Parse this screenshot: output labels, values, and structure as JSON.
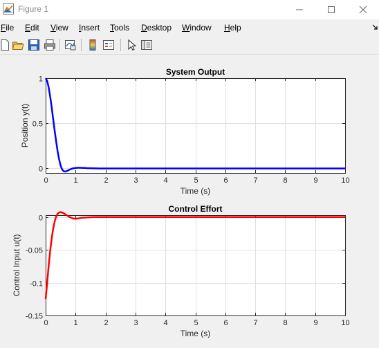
{
  "window": {
    "title": "Figure 1"
  },
  "menu": {
    "file": {
      "u": "F",
      "rest": "ile"
    },
    "edit": {
      "u": "E",
      "rest": "dit"
    },
    "view": {
      "u": "V",
      "rest": "iew"
    },
    "insert": {
      "u": "I",
      "rest": "nsert"
    },
    "tools": {
      "u": "T",
      "rest": "ools"
    },
    "desktop": {
      "u": "D",
      "rest": "esktop"
    },
    "window": {
      "u": "W",
      "rest": "indow"
    },
    "help": {
      "u": "H",
      "rest": "elp"
    }
  },
  "toolbar_icons": [
    "new-figure-icon",
    "open-file-icon",
    "save-icon",
    "print-icon",
    "link-plot-icon",
    "insert-colorbar-icon",
    "insert-legend-icon",
    "edit-plot-icon",
    "property-inspector-icon"
  ],
  "colors": {
    "series1": "#0000ff",
    "series2": "#ff0000",
    "grid": "#dfdfdf"
  },
  "chart_data": [
    {
      "type": "line",
      "title": "System Output",
      "xlabel": "Time (s)",
      "ylabel": "Position y(t)",
      "xlim": [
        0,
        10
      ],
      "ylim": [
        -0.05,
        1
      ],
      "xticks": [
        0,
        1,
        2,
        3,
        4,
        5,
        6,
        7,
        8,
        9,
        10
      ],
      "yticks": [
        0,
        0.5,
        1
      ],
      "ytick_labels": [
        "0",
        "0.5",
        "1"
      ],
      "grid": true,
      "series": [
        {
          "color": "#0000ff",
          "x": [
            0,
            0.05,
            0.1,
            0.15,
            0.2,
            0.25,
            0.3,
            0.35,
            0.4,
            0.45,
            0.5,
            0.55,
            0.6,
            0.65,
            0.7,
            0.75,
            0.8,
            0.85,
            0.9,
            1.0,
            1.1,
            1.2,
            1.3,
            1.4,
            1.6,
            1.8,
            2.0,
            3,
            4,
            5,
            6,
            7,
            8,
            9,
            10
          ],
          "y": [
            1,
            0.97,
            0.9,
            0.8,
            0.68,
            0.55,
            0.42,
            0.3,
            0.19,
            0.1,
            0.03,
            -0.01,
            -0.03,
            -0.035,
            -0.03,
            -0.022,
            -0.013,
            -0.006,
            0.0,
            0.006,
            0.008,
            0.007,
            0.005,
            0.003,
            0.001,
            0,
            0,
            0,
            0,
            0,
            0,
            0,
            0,
            0,
            0
          ]
        }
      ]
    },
    {
      "type": "line",
      "title": "Control Effort",
      "xlabel": "Time (s)",
      "ylabel": "Control Input u(t)",
      "xlim": [
        0,
        10
      ],
      "ylim": [
        -0.15,
        0.003
      ],
      "xticks": [
        0,
        1,
        2,
        3,
        4,
        5,
        6,
        7,
        8,
        9,
        10
      ],
      "yticks": [
        0,
        -0.05,
        -0.1,
        -0.15
      ],
      "ytick_labels": [
        "0",
        "-0.05",
        "-0.1",
        "-0.15"
      ],
      "grid": true,
      "series": [
        {
          "color": "#ff0000",
          "x": [
            0,
            0.05,
            0.1,
            0.15,
            0.2,
            0.25,
            0.3,
            0.35,
            0.4,
            0.45,
            0.5,
            0.55,
            0.6,
            0.7,
            0.8,
            0.9,
            1.0,
            1.1,
            1.2,
            1.4,
            1.6,
            2.0,
            3,
            4,
            5,
            6,
            7,
            8,
            9,
            10
          ],
          "y": [
            -0.125,
            -0.1,
            -0.075,
            -0.052,
            -0.033,
            -0.018,
            -0.007,
            0.001,
            0.005,
            0.007,
            0.0075,
            0.007,
            0.006,
            0.003,
            0.0,
            -0.002,
            -0.0025,
            -0.002,
            -0.001,
            -0.0005,
            0,
            0,
            0,
            0,
            0,
            0,
            0,
            0,
            0,
            0
          ]
        }
      ]
    }
  ]
}
